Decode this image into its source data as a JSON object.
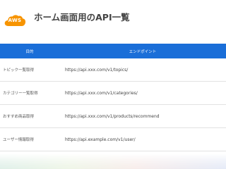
{
  "logo": {
    "text": "AWS",
    "color": "#f79400"
  },
  "title": "ホーム画面用のAPI一覧",
  "table": {
    "header_color": "#1a6ed8",
    "headers": {
      "purpose": "目的",
      "endpoint": "エンドポイント"
    },
    "rows": [
      {
        "purpose": "トピック一覧取得",
        "endpoint": "https://api.xxx.com/v1/topics/"
      },
      {
        "purpose": "カテゴリー一覧取得",
        "endpoint": "https://api.xxx.com/v1/categories/"
      },
      {
        "purpose": "おすすめ商品取得",
        "endpoint": "https://api.xxx.com/v1/products/recommend"
      },
      {
        "purpose": "ユーザー情報取得",
        "endpoint": "https://api.example.com/v1/user/"
      }
    ]
  }
}
